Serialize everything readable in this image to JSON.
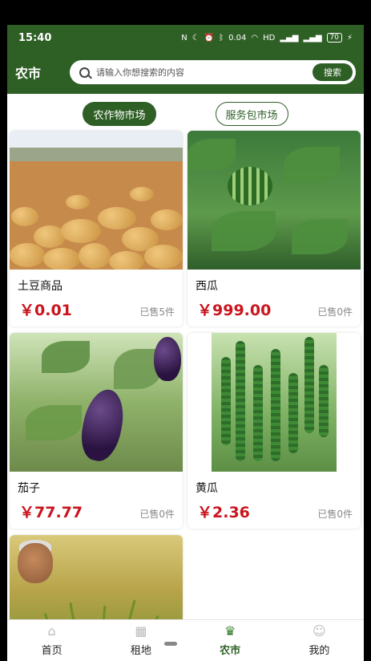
{
  "status_bar": {
    "time": "15:40",
    "net_speed": "0.04",
    "battery": "70"
  },
  "header": {
    "title": "农市",
    "search_placeholder": "请输入你想搜索的内容",
    "search_button": "搜索"
  },
  "tabs": [
    {
      "label": "农作物市场",
      "active": true
    },
    {
      "label": "服务包市场",
      "active": false
    }
  ],
  "products": [
    {
      "name": "土豆商品",
      "price": "￥0.01",
      "sold": "已售5件"
    },
    {
      "name": "西瓜",
      "price": "￥999.00",
      "sold": "已售0件"
    },
    {
      "name": "茄子",
      "price": "￥77.77",
      "sold": "已售0件"
    },
    {
      "name": "黄瓜",
      "price": "￥2.36",
      "sold": "已售0件"
    }
  ],
  "bottom_nav": [
    {
      "label": "首页",
      "icon": "home-icon",
      "active": false
    },
    {
      "label": "租地",
      "icon": "grid-icon",
      "active": false
    },
    {
      "label": "农市",
      "icon": "crown-icon",
      "active": true
    },
    {
      "label": "我的",
      "icon": "user-icon",
      "active": false
    }
  ],
  "colors": {
    "primary": "#2e5f25",
    "price": "#c9151e"
  }
}
